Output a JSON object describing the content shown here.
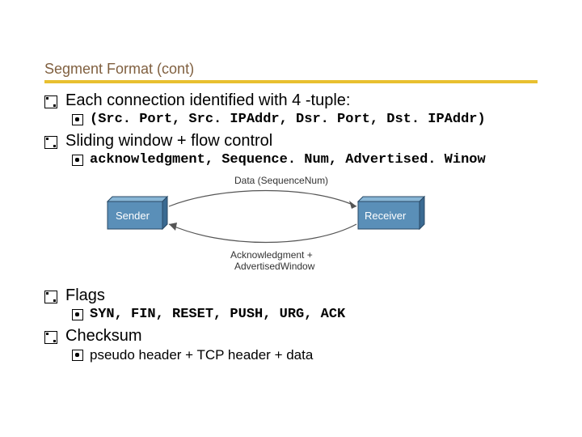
{
  "title": "Segment Format (cont)",
  "bullets": {
    "b1": "Each connection identified with 4 -tuple:",
    "b1s": "(Src. Port, Src. IPAddr, Dsr. Port, Dst. IPAddr)",
    "b2": "Sliding window + flow control",
    "b2s": "acknowledgment, Sequence. Num, Advertised. Winow",
    "b3": "Flags",
    "b3s": "SYN, FIN, RESET, PUSH, URG, ACK",
    "b4": "Checksum",
    "b4s": "pseudo header + TCP header + data"
  },
  "diagram": {
    "sender": "Sender",
    "receiver": "Receiver",
    "top_label": "Data (SequenceNum)",
    "bottom_label_1": "Acknowledgment +",
    "bottom_label_2": "AdvertisedWindow"
  }
}
